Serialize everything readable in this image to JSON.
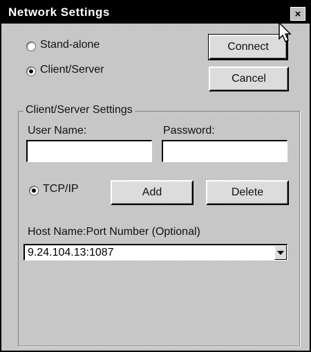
{
  "window": {
    "title": "Network Settings",
    "close_glyph": "×"
  },
  "mode": {
    "standalone_label": "Stand-alone",
    "standalone_selected": false,
    "client_server_label": "Client/Server",
    "client_server_selected": true
  },
  "buttons": {
    "connect": "Connect",
    "cancel": "Cancel",
    "add": "Add",
    "delete": "Delete"
  },
  "group": {
    "label": "Client/Server Settings",
    "user_name_label": "User Name:",
    "user_name_value": "",
    "password_label": "Password:",
    "password_value": "",
    "protocol_label": "TCP/IP",
    "protocol_selected": true,
    "host_label": "Host Name:Port Number (Optional)",
    "host_value": "9.24.104.13:1087"
  },
  "icons": {
    "close": "close-icon",
    "dropdown": "chevron-down-icon",
    "cursor": "mouse-pointer-icon"
  },
  "colors": {
    "titlebar": "#000000",
    "face": "#c0c0c0"
  }
}
